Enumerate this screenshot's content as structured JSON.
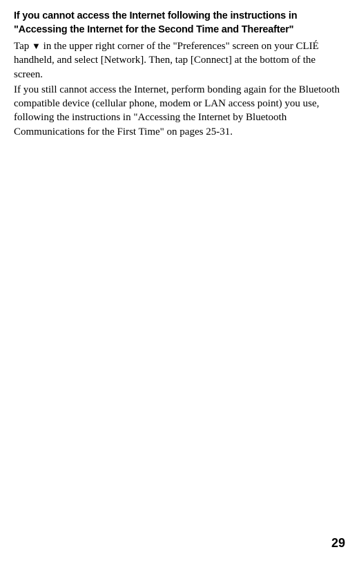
{
  "heading": "If you cannot access the Internet following the instructions in \"Accessing the Internet for the Second Time and Thereafter\"",
  "paragraph1_prefix": "Tap ",
  "paragraph1_suffix": " in the upper right corner of the \"Preferences\" screen on your CLIÉ handheld, and select [Network]. Then, tap [Connect] at the bottom of the screen.",
  "paragraph2": "If you still cannot access the Internet, perform bonding again for the Bluetooth compatible device (cellular phone, modem or LAN access point) you use, following the instructions in \"Accessing the Internet by Bluetooth Communications for the First Time\" on pages 25-31.",
  "page_number": "29"
}
